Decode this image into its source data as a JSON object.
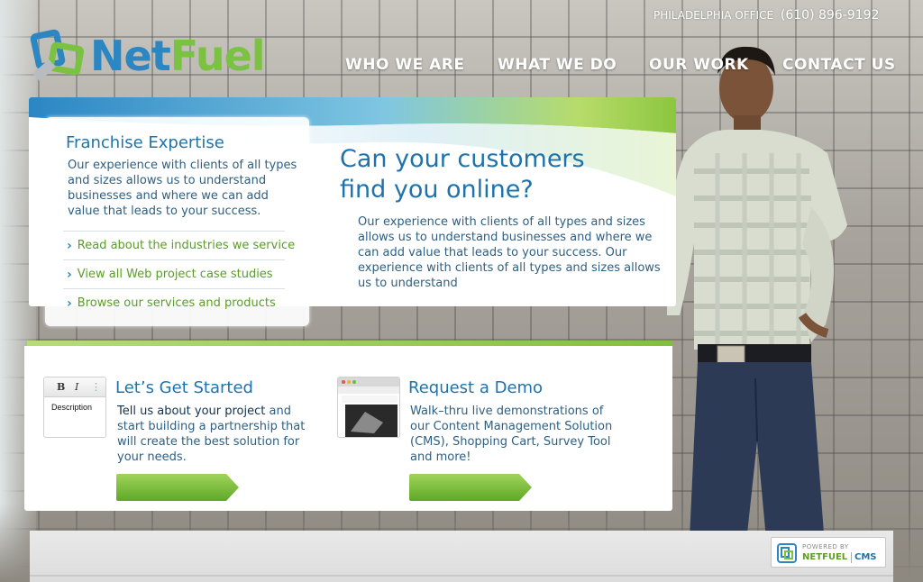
{
  "header": {
    "logo_net": "Net",
    "logo_fuel": "Fuel",
    "office_label": "PHILADELPHIA OFFICE",
    "office_phone": "(610) 896-9192"
  },
  "nav": {
    "items": [
      {
        "label": "WHO WE ARE"
      },
      {
        "label": "WHAT WE DO"
      },
      {
        "label": "OUR WORK"
      },
      {
        "label": "CONTACT US"
      }
    ]
  },
  "franchise": {
    "title": "Franchise Expertise",
    "text": "Our experience with clients of all types and sizes allows us to understand businesses and where we can add value that leads to your success.",
    "links": [
      {
        "label": "Read about the industries we service"
      },
      {
        "label": "View all Web project case studies"
      },
      {
        "label": "Browse our services and products"
      }
    ]
  },
  "hero": {
    "headline": "Can your customers find you online?",
    "text": "Our experience with clients of all types and sizes allows us to understand  businesses and where we can add value that leads to your success. Our experience with clients of all types and sizes allows us to understand"
  },
  "slider": {
    "count": 5,
    "active_index": 0
  },
  "get_started": {
    "title": "Let’s Get Started",
    "text_bold": "Tell us about your project",
    "text_rest": " and start building a partnership that will create the best solution for your needs.",
    "editor_label": "Description"
  },
  "demo": {
    "title": "Request a Demo",
    "text": "Walk–thru live demonstrations of our Content Management Solution (CMS), Shopping Cart, Survey Tool and more!"
  },
  "footer": {
    "powered_by": "POWERED BY",
    "brand": "NETFUEL",
    "product": "CMS"
  },
  "colors": {
    "brand_blue": "#1f73ab",
    "brand_green": "#7cc242",
    "link_green": "#5a9e23"
  },
  "icons": {
    "logo": "netfuel-logo-icon",
    "chevron": "chevron-right-icon",
    "button_arrow": "arrow-button-icon"
  }
}
